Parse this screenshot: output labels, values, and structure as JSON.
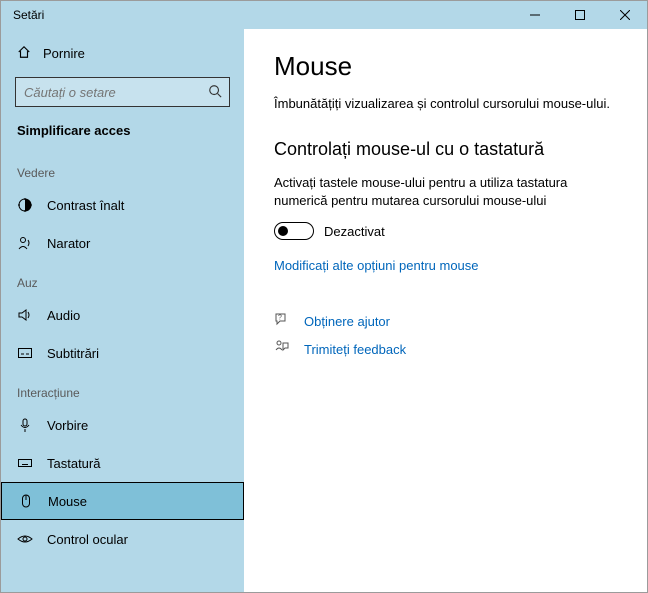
{
  "window": {
    "title": "Setări"
  },
  "sidebar": {
    "home": "Pornire",
    "search_placeholder": "Căutați o setare",
    "category": "Simplificare acces",
    "groups": [
      {
        "label": "Vedere",
        "items": [
          {
            "id": "contrast",
            "label": "Contrast înalt"
          },
          {
            "id": "narrator",
            "label": "Narator"
          }
        ]
      },
      {
        "label": "Auz",
        "items": [
          {
            "id": "audio",
            "label": "Audio"
          },
          {
            "id": "subtitles",
            "label": "Subtitrări"
          }
        ]
      },
      {
        "label": "Interacțiune",
        "items": [
          {
            "id": "speech",
            "label": "Vorbire"
          },
          {
            "id": "keyboard",
            "label": "Tastatură"
          },
          {
            "id": "mouse",
            "label": "Mouse",
            "selected": true
          },
          {
            "id": "eye",
            "label": "Control ocular"
          }
        ]
      }
    ]
  },
  "main": {
    "title": "Mouse",
    "description": "Îmbunătățiți vizualizarea și controlul cursorului mouse-ului.",
    "section_heading": "Controlați mouse-ul cu o tastatură",
    "paragraph": "Activați tastele mouse-ului pentru a utiliza tastatura numerică pentru mutarea cursorului mouse-ului",
    "toggle_state": "Dezactivat",
    "more_options_link": "Modificați alte opțiuni pentru mouse",
    "help": "Obținere ajutor",
    "feedback": "Trimiteți feedback"
  }
}
